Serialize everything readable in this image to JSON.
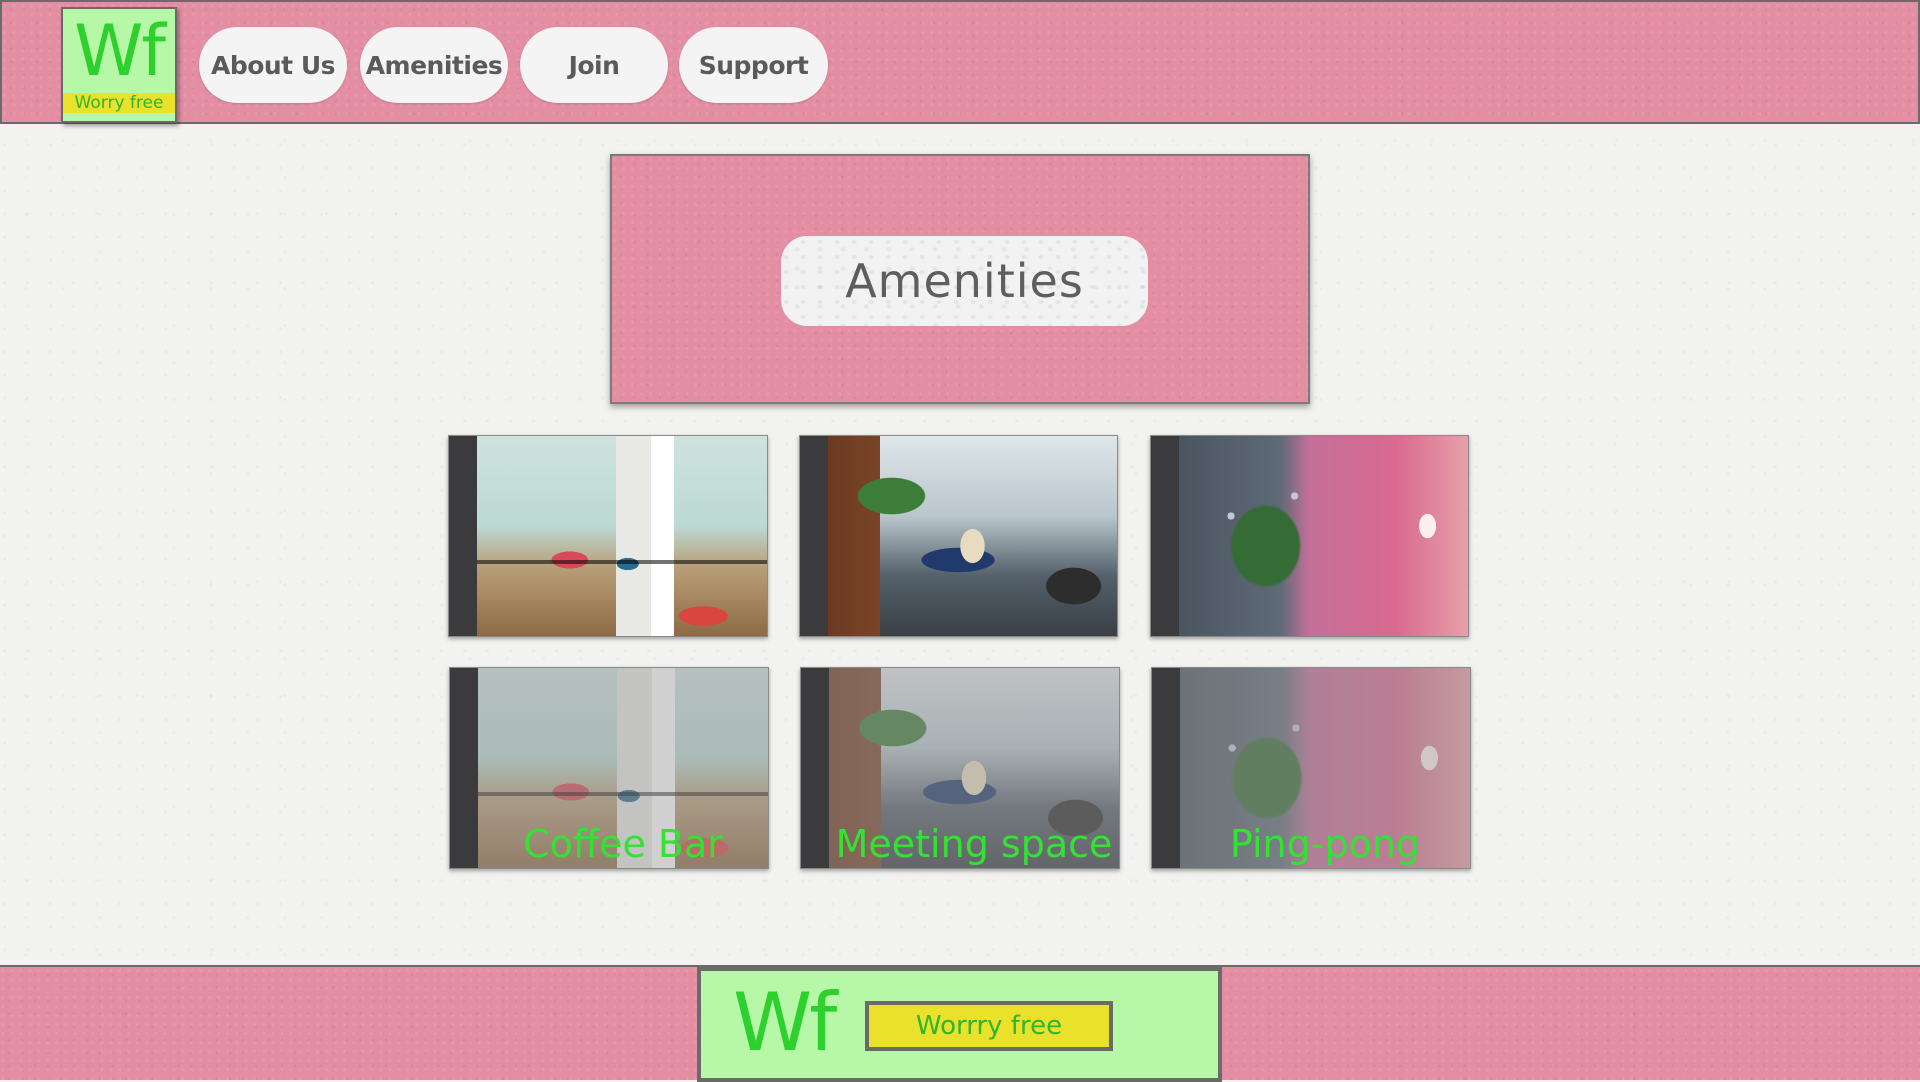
{
  "header": {
    "logo": {
      "mark": "Wf",
      "tagline": "Worry free"
    },
    "nav": [
      {
        "label": "About Us"
      },
      {
        "label": "Amenities"
      },
      {
        "label": "Join"
      },
      {
        "label": "Support"
      }
    ]
  },
  "hero": {
    "title": "Amenities"
  },
  "gallery": [
    {
      "caption": "Coffee Bar"
    },
    {
      "caption": "Meeting space"
    },
    {
      "caption": "Ping-pong"
    }
  ],
  "footer": {
    "logo": {
      "mark": "Wf",
      "tagline": "Worrry free"
    }
  },
  "colors": {
    "brand_pink": "#e48ea3",
    "logo_green": "#b7f7a8",
    "logo_text_green": "#2ed02e",
    "tag_yellow": "#e9e12a",
    "caption_green": "#33e233"
  }
}
